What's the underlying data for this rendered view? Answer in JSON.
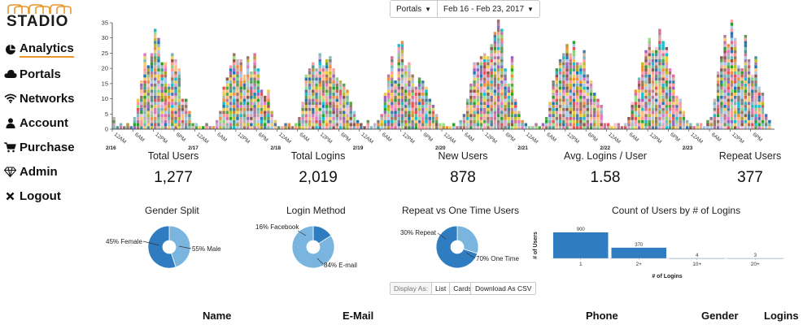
{
  "logo": {
    "text": "STADIO"
  },
  "sidebar": {
    "items": [
      {
        "label": "Analytics",
        "icon": "pie-chart-icon",
        "active": true
      },
      {
        "label": "Portals",
        "icon": "cloud-icon"
      },
      {
        "label": "Networks",
        "icon": "wifi-icon"
      },
      {
        "label": "Account",
        "icon": "user-icon"
      },
      {
        "label": "Purchase",
        "icon": "cart-icon"
      },
      {
        "label": "Admin",
        "icon": "diamond-icon"
      },
      {
        "label": "Logout",
        "icon": "close-icon"
      }
    ]
  },
  "controls": {
    "portals_label": "Portals",
    "date_range": "Feb 16 - Feb 23, 2017"
  },
  "chart_data": [
    {
      "type": "bar",
      "stacked": true,
      "ylim": [
        0,
        35
      ],
      "y_ticks": [
        0,
        5,
        10,
        15,
        20,
        25,
        30,
        35
      ],
      "hour_tick_labels": [
        "12AM",
        "6AM",
        "12PM",
        "6PM"
      ],
      "dates": [
        "2/16",
        "2/17",
        "2/18",
        "2/19",
        "2/20",
        "2/21",
        "2/22",
        "2/23"
      ],
      "day_series": [
        [
          4,
          1,
          2,
          1,
          2,
          1,
          4,
          10,
          16,
          25,
          21,
          25,
          33,
          30,
          22,
          22,
          15,
          25,
          23,
          20,
          10,
          10,
          6,
          2
        ],
        [
          2,
          1,
          1,
          2,
          1,
          1,
          3,
          6,
          14,
          17,
          21,
          25,
          23,
          23,
          18,
          24,
          19,
          25,
          20,
          13,
          11,
          13,
          6,
          3
        ],
        [
          1,
          1,
          2,
          2,
          1,
          2,
          4,
          9,
          18,
          20,
          22,
          20,
          25,
          21,
          23,
          24,
          20,
          17,
          16,
          15,
          13,
          9,
          6,
          3
        ],
        [
          2,
          1,
          3,
          1,
          2,
          3,
          5,
          12,
          18,
          24,
          16,
          28,
          29,
          21,
          22,
          18,
          14,
          17,
          16,
          14,
          10,
          8,
          5,
          2
        ],
        [
          2,
          1,
          1,
          2,
          1,
          3,
          5,
          10,
          15,
          22,
          22,
          24,
          25,
          24,
          28,
          32,
          38,
          33,
          20,
          15,
          24,
          10,
          6,
          3
        ],
        [
          2,
          1,
          1,
          2,
          1,
          2,
          4,
          9,
          16,
          20,
          23,
          25,
          28,
          25,
          29,
          22,
          22,
          26,
          18,
          16,
          12,
          10,
          8,
          2
        ],
        [
          2,
          1,
          2,
          2,
          1,
          2,
          4,
          9,
          13,
          17,
          22,
          26,
          30,
          26,
          27,
          33,
          29,
          27,
          20,
          18,
          11,
          10,
          6,
          3
        ],
        [
          2,
          1,
          2,
          2,
          1,
          3,
          4,
          10,
          19,
          24,
          31,
          28,
          37,
          30,
          21,
          20,
          31,
          23,
          18,
          24,
          14,
          12,
          5,
          3
        ]
      ]
    },
    {
      "type": "pie",
      "title": "Gender Split",
      "slices": [
        {
          "label": "45% Female",
          "value": 45,
          "color": "#7ab5df"
        },
        {
          "label": "55% Male",
          "value": 55,
          "color": "#2f7cc0"
        }
      ]
    },
    {
      "type": "pie",
      "title": "Login Method",
      "slices": [
        {
          "label": "16% Facebook",
          "value": 16,
          "color": "#2f7cc0"
        },
        {
          "label": "84% E-mail",
          "value": 84,
          "color": "#7ab5df"
        }
      ]
    },
    {
      "type": "pie",
      "title": "Repeat vs One Time Users",
      "slices": [
        {
          "label": "30% Repeat",
          "value": 30,
          "color": "#7ab5df"
        },
        {
          "label": "70% One Time",
          "value": 70,
          "color": "#2f7cc0"
        }
      ]
    },
    {
      "type": "bar",
      "title": "Count of Users by # of Logins",
      "categories": [
        "1",
        "2+",
        "10+",
        "20+"
      ],
      "values": [
        900,
        370,
        4,
        3
      ],
      "xlabel": "# of Logins",
      "ylabel": "# of Users",
      "color": "#2f7cc0"
    }
  ],
  "stats": [
    {
      "label": "Total Users",
      "value": "1,277"
    },
    {
      "label": "Total Logins",
      "value": "2,019"
    },
    {
      "label": "New Users",
      "value": "878"
    },
    {
      "label": "Avg. Logins / User",
      "value": "1.58"
    },
    {
      "label": "Repeat Users",
      "value": "377"
    }
  ],
  "display": {
    "label": "Display As:",
    "list": "List",
    "cards": "Cards",
    "csv": "Download As CSV"
  },
  "table": {
    "headers": [
      "Name",
      "E-Mail",
      "Phone",
      "Gender",
      "Logins"
    ]
  },
  "palette": [
    "#f28e3b",
    "#e15759",
    "#76b7b2",
    "#59a14f",
    "#edc948",
    "#b07aa1",
    "#ff9da7",
    "#9c755f",
    "#bab0ac",
    "#4e79a7",
    "#a0cbe8",
    "#ffbe7d",
    "#8cd17d",
    "#b6992d",
    "#f1ce63",
    "#499894",
    "#86bcb6",
    "#d37295",
    "#fabfd2",
    "#d4a6c8",
    "#9d7660",
    "#d7b5a6",
    "#2ca02c",
    "#1f77b4",
    "#17becf",
    "#bcbd22",
    "#9467bd",
    "#8c564b",
    "#e377c2",
    "#7f7f7f",
    "#aec7e8",
    "#98df8a",
    "#ff9896",
    "#c5b0d5"
  ]
}
